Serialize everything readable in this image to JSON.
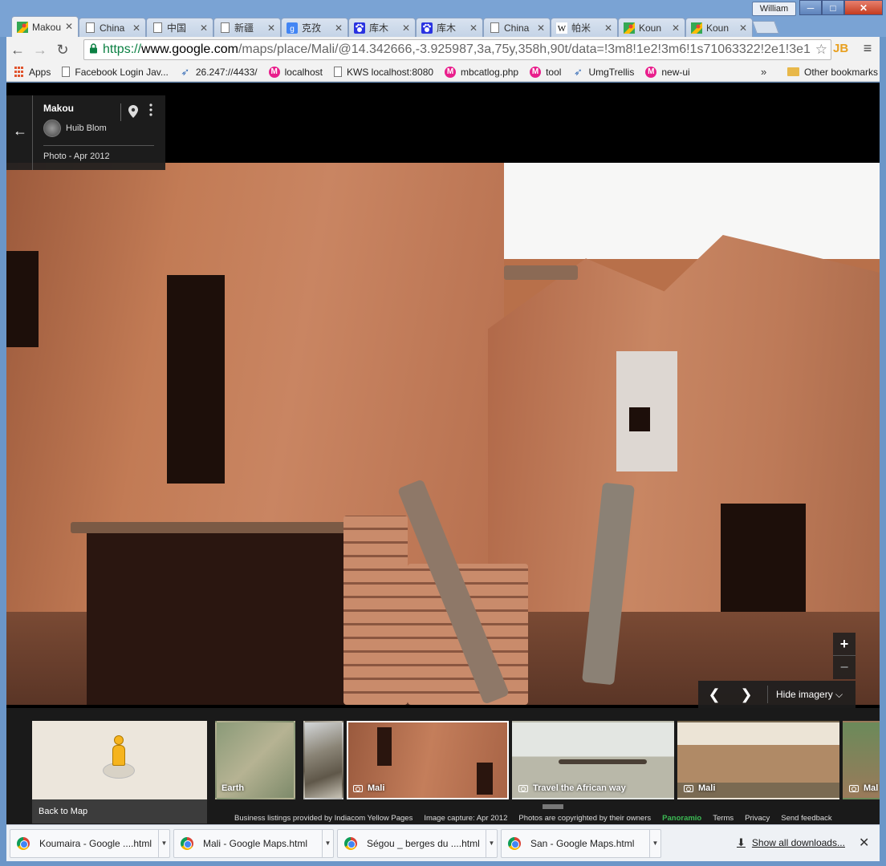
{
  "window": {
    "user": "William",
    "minimize": "─",
    "maximize": "□",
    "close": "✕"
  },
  "tabs": [
    {
      "title": "Makou",
      "icon": "google-maps-icon",
      "active": true
    },
    {
      "title": "China",
      "icon": "page-icon"
    },
    {
      "title": "中国",
      "icon": "page-icon"
    },
    {
      "title": "新疆",
      "icon": "page-icon"
    },
    {
      "title": "克孜",
      "icon": "google-g-icon"
    },
    {
      "title": "库木",
      "icon": "baidu-paw-icon"
    },
    {
      "title": "库木",
      "icon": "baidu-paw-icon"
    },
    {
      "title": "China",
      "icon": "page-icon"
    },
    {
      "title": "帕米",
      "icon": "wikipedia-icon"
    },
    {
      "title": "Koun",
      "icon": "google-maps-icon"
    },
    {
      "title": "Koun",
      "icon": "google-maps-icon"
    }
  ],
  "toolbar": {
    "back": "←",
    "forward": "→",
    "reload": "↻",
    "url_scheme": "https://",
    "url_host": "www.google.com",
    "url_path": "/maps/place/Mali/@14.342666,-3.925987,3a,75y,358h,90t/data=!3m8!1e2!3m6!1s71063322!2e1!3e1",
    "star": "☆",
    "ext": "JB",
    "menu": "≡"
  },
  "bookmarks": {
    "items": [
      {
        "label": "Apps",
        "icon": "apps-grid-icon"
      },
      {
        "label": "Facebook Login Jav...",
        "icon": "page-icon"
      },
      {
        "label": "26.247://4433/",
        "icon": "arrow-bookmark-icon"
      },
      {
        "label": "localhost",
        "icon": "m-circle-icon"
      },
      {
        "label": "KWS localhost:8080",
        "icon": "page-icon"
      },
      {
        "label": "mbcatlog.php",
        "icon": "m-circle-icon"
      },
      {
        "label": "tool",
        "icon": "m-circle-icon"
      },
      {
        "label": "UmgTrellis",
        "icon": "arrow-bookmark-icon"
      },
      {
        "label": "new-ui",
        "icon": "m-circle-icon"
      }
    ],
    "more": "»",
    "other": "Other bookmarks"
  },
  "info_card": {
    "back": "←",
    "place": "Makou",
    "author": "Huib Blom",
    "date": "Photo - Apr 2012"
  },
  "controls": {
    "zoom_in": "+",
    "zoom_out": "−",
    "prev": "❮",
    "next": "❯",
    "hide_imagery": "Hide imagery ⌵"
  },
  "strip": {
    "back_to_map": "Back to Map",
    "thumbs": [
      {
        "label": "Earth",
        "camera": false
      },
      {
        "label": "",
        "camera": false
      },
      {
        "label": "Mali",
        "camera": true,
        "selected": true
      },
      {
        "label": "Travel the African way",
        "camera": true
      },
      {
        "label": "Mali",
        "camera": true
      },
      {
        "label": "Mal",
        "camera": true
      }
    ],
    "footer": {
      "listings": "Business listings provided by Indiacom Yellow Pages",
      "capture": "Image capture: Apr 2012",
      "copyright": "Photos are copyrighted by their owners",
      "panoramio": "Panoramio",
      "terms": "Terms",
      "privacy": "Privacy",
      "feedback": "Send feedback"
    }
  },
  "downloads": {
    "items": [
      {
        "name": "Koumaira - Google ....html"
      },
      {
        "name": "Mali - Google Maps.html"
      },
      {
        "name": "Ségou _ berges du ....html"
      },
      {
        "name": "San - Google Maps.html"
      }
    ],
    "show_all": "Show all downloads...",
    "close": "✕"
  },
  "colors": {
    "window_chrome": "#7aa3d4",
    "url_secure": "#0b8043",
    "panoramio_green": "#3cba54",
    "bookmark_m": "#e91e8c"
  }
}
